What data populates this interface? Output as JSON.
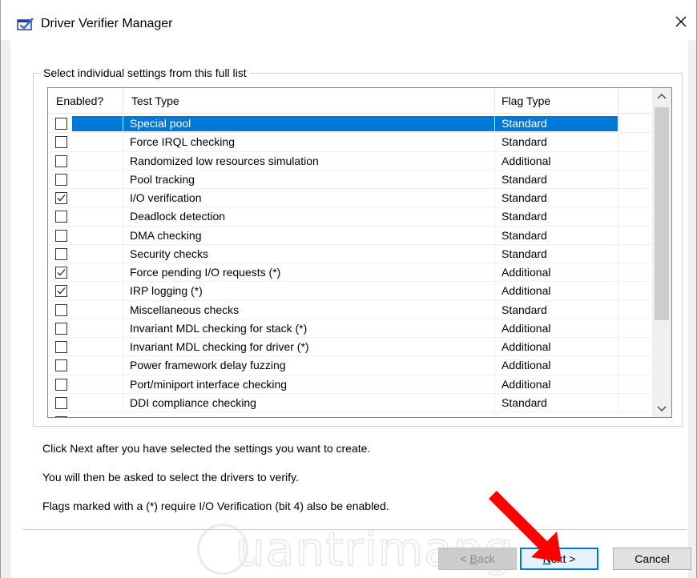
{
  "window": {
    "title": "Driver Verifier Manager",
    "icon": "driver-verifier-app-icon",
    "close_icon": "close-icon"
  },
  "group": {
    "legend": "Select individual settings from this full list"
  },
  "list": {
    "columns": [
      "Enabled?",
      "Test Type",
      "Flag Type"
    ],
    "rows": [
      {
        "enabled": false,
        "test": "Special pool",
        "flag": "Standard",
        "selected": true
      },
      {
        "enabled": false,
        "test": "Force IRQL checking",
        "flag": "Standard"
      },
      {
        "enabled": false,
        "test": "Randomized low resources simulation",
        "flag": "Additional"
      },
      {
        "enabled": false,
        "test": "Pool tracking",
        "flag": "Standard"
      },
      {
        "enabled": true,
        "test": "I/O verification",
        "flag": "Standard"
      },
      {
        "enabled": false,
        "test": "Deadlock detection",
        "flag": "Standard"
      },
      {
        "enabled": false,
        "test": "DMA checking",
        "flag": "Standard"
      },
      {
        "enabled": false,
        "test": "Security checks",
        "flag": "Standard"
      },
      {
        "enabled": true,
        "test": "Force pending I/O requests (*)",
        "flag": "Additional"
      },
      {
        "enabled": true,
        "test": "IRP logging (*)",
        "flag": "Additional"
      },
      {
        "enabled": false,
        "test": "Miscellaneous checks",
        "flag": "Standard"
      },
      {
        "enabled": false,
        "test": "Invariant MDL checking for stack (*)",
        "flag": "Additional"
      },
      {
        "enabled": false,
        "test": "Invariant MDL checking for driver (*)",
        "flag": "Additional"
      },
      {
        "enabled": false,
        "test": "Power framework delay fuzzing",
        "flag": "Additional"
      },
      {
        "enabled": false,
        "test": "Port/miniport interface checking",
        "flag": "Additional"
      },
      {
        "enabled": false,
        "test": "DDI compliance checking",
        "flag": "Standard"
      }
    ]
  },
  "info": {
    "line1": "Click Next after you have selected the settings you want to create.",
    "line2": "You will then be asked to select the drivers to verify.",
    "line3": "Flags marked with a (*) require I/O Verification (bit 4) also be enabled."
  },
  "buttons": {
    "back": {
      "prefix": "< ",
      "mnemonic": "B",
      "rest": "ack"
    },
    "next": {
      "mnemonic": "N",
      "rest": "ext >"
    },
    "cancel": "Cancel"
  },
  "watermark": {
    "text": "uantrimang"
  },
  "colors": {
    "selection": "#0078d7",
    "arrow": "#ff0000"
  }
}
